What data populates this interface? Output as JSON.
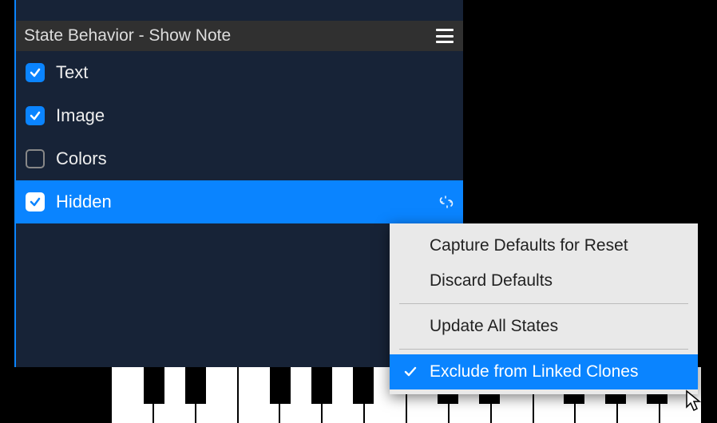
{
  "panel": {
    "title": "State Behavior - Show Note",
    "props": [
      {
        "label": "Text",
        "checked": true,
        "selected": false
      },
      {
        "label": "Image",
        "checked": true,
        "selected": false
      },
      {
        "label": "Colors",
        "checked": false,
        "selected": false
      },
      {
        "label": "Hidden",
        "checked": true,
        "selected": true
      }
    ]
  },
  "menu": {
    "items": [
      {
        "label": "Capture Defaults for Reset",
        "highlight": false,
        "checked": false
      },
      {
        "label": "Discard Defaults",
        "highlight": false,
        "checked": false
      },
      {
        "sep": true
      },
      {
        "label": "Update All States",
        "highlight": false,
        "checked": false
      },
      {
        "sep": true
      },
      {
        "label": "Exclude from Linked Clones",
        "highlight": true,
        "checked": true
      }
    ]
  }
}
